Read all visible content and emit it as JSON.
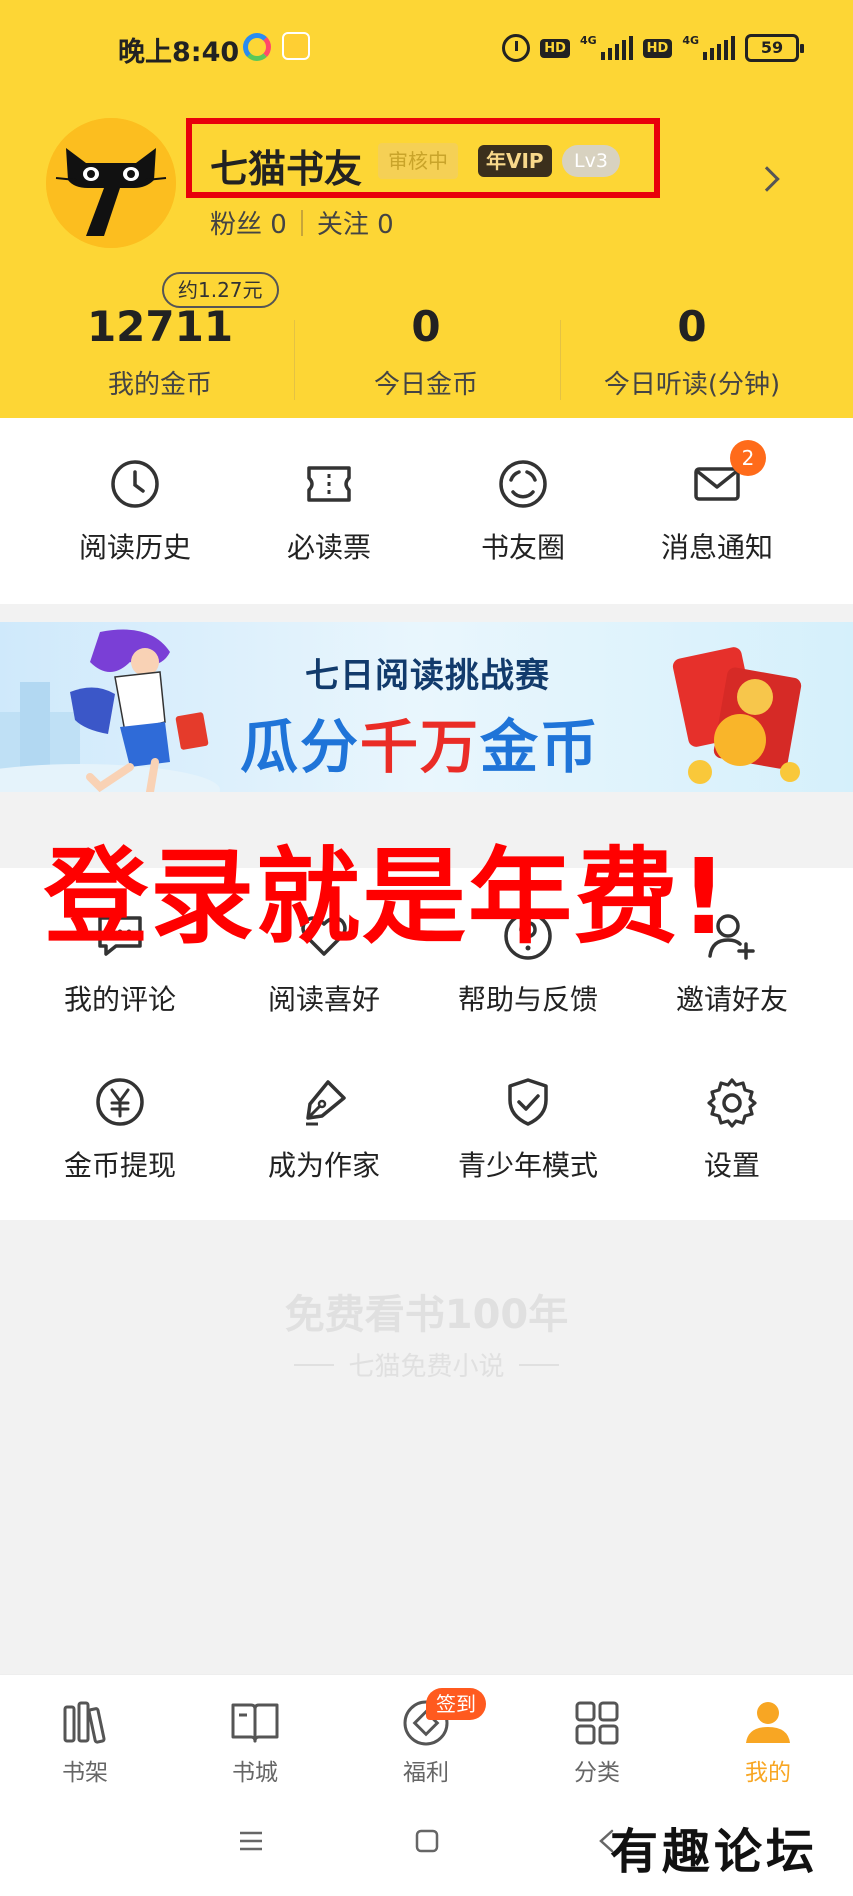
{
  "status_bar": {
    "time": "晚上8:40",
    "hd1": "HD",
    "net1": "4G",
    "hd2": "HD",
    "net2": "4G",
    "battery": "59"
  },
  "profile": {
    "username": "七猫书友",
    "review_badge": "审核中",
    "vip_badge": "年VIP",
    "level_badge": "Lv3",
    "fans_label": "粉丝",
    "fans_count": "0",
    "follow_label": "关注",
    "follow_count": "0"
  },
  "stats": {
    "coin_bubble": "约1.27元",
    "items": [
      {
        "value": "12711",
        "label": "我的金币"
      },
      {
        "value": "0",
        "label": "今日金币"
      },
      {
        "value": "0",
        "label": "今日听读(分钟)"
      }
    ]
  },
  "quick_actions": [
    {
      "label": "阅读历史",
      "icon": "clock-icon"
    },
    {
      "label": "必读票",
      "icon": "ticket-icon"
    },
    {
      "label": "书友圈",
      "icon": "circle-icon"
    },
    {
      "label": "消息通知",
      "icon": "mail-icon"
    }
  ],
  "message_badge": "2",
  "banner": {
    "subtitle": "七日阅读挑战赛",
    "title_blue_1": "瓜分",
    "title_red": "千万",
    "title_blue_2": "金币"
  },
  "overlay_text": "登录就是年费!",
  "grid_menu": [
    {
      "label": "我的评论",
      "icon": "comment-icon"
    },
    {
      "label": "阅读喜好",
      "icon": "heart-icon"
    },
    {
      "label": "帮助与反馈",
      "icon": "help-icon"
    },
    {
      "label": "邀请好友",
      "icon": "add-user-icon"
    },
    {
      "label": "金币提现",
      "icon": "yen-icon"
    },
    {
      "label": "成为作家",
      "icon": "pen-icon"
    },
    {
      "label": "青少年模式",
      "icon": "shield-icon"
    },
    {
      "label": "设置",
      "icon": "gear-icon"
    }
  ],
  "slogan": {
    "main": "免费看书100年",
    "sub": "七猫免费小说"
  },
  "bottom_nav": [
    {
      "label": "书架",
      "icon": "bookshelf-icon"
    },
    {
      "label": "书城",
      "icon": "book-icon"
    },
    {
      "label": "福利",
      "icon": "gift-icon"
    },
    {
      "label": "分类",
      "icon": "grid-icon"
    },
    {
      "label": "我的",
      "icon": "user-icon"
    }
  ],
  "signin_badge": "签到",
  "watermark": "有趣论坛",
  "colors": {
    "header_bg": "#fdd635",
    "accent": "#f8a623",
    "badge_orange": "#ff6b1a",
    "overlay_red": "#ff0000"
  }
}
